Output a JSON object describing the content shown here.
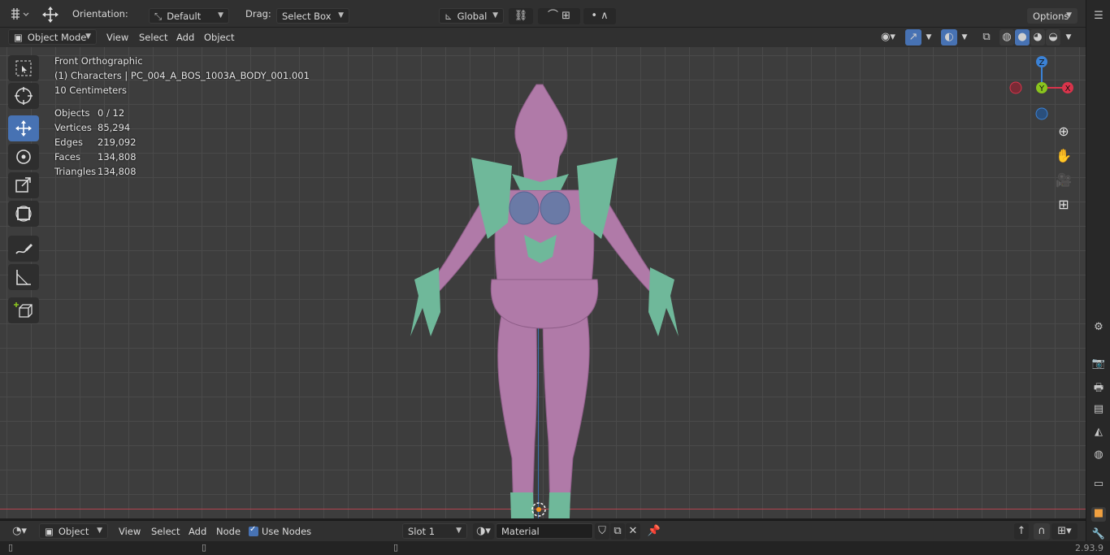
{
  "tool_header": {
    "orientation_label": "Orientation:",
    "orientation_value": "Default",
    "drag_label": "Drag:",
    "drag_value": "Select Box",
    "transform_orientation": "Global",
    "options_label": "Options"
  },
  "viewport_header": {
    "mode": "Object Mode",
    "menus": [
      "View",
      "Select",
      "Add",
      "Object"
    ]
  },
  "overlay": {
    "view_name": "Front Orthographic",
    "collection_object": "(1) Characters | PC_004_A_BOS_1003A_BODY_001.001",
    "scale": "10 Centimeters",
    "stats": [
      {
        "label": "Objects",
        "value": "0 / 12"
      },
      {
        "label": "Vertices",
        "value": "85,294"
      },
      {
        "label": "Edges",
        "value": "219,092"
      },
      {
        "label": "Faces",
        "value": "134,808"
      },
      {
        "label": "Triangles",
        "value": "134,808"
      }
    ]
  },
  "gizmo": {
    "z": "Z",
    "y": "Y",
    "x": "X"
  },
  "node_header": {
    "editor_mode": "Object",
    "menus": [
      "View",
      "Select",
      "Add",
      "Node"
    ],
    "use_nodes_label": "Use Nodes",
    "slot": "Slot 1",
    "material": "Material"
  },
  "status_bar": {
    "version": "2.93.9"
  },
  "colors": {
    "accent": "#4772b3",
    "body": "#b07aa8",
    "armor": "#6fb89a",
    "chest": "#6a7aa6",
    "x_axis": "#d9344b",
    "y_axis": "#8ac41e",
    "z_axis": "#3b82d6"
  },
  "icons": [
    "editor-type-icon",
    "move-gizmo-icon",
    "pivot-icon",
    "snap-icon",
    "proportional-icon",
    "visibility-icon",
    "gizmo-icon",
    "overlay-icon",
    "xray-icon",
    "shading-solid-icon",
    "zoom-icon",
    "hand-icon",
    "camera-icon",
    "grid-icon"
  ]
}
